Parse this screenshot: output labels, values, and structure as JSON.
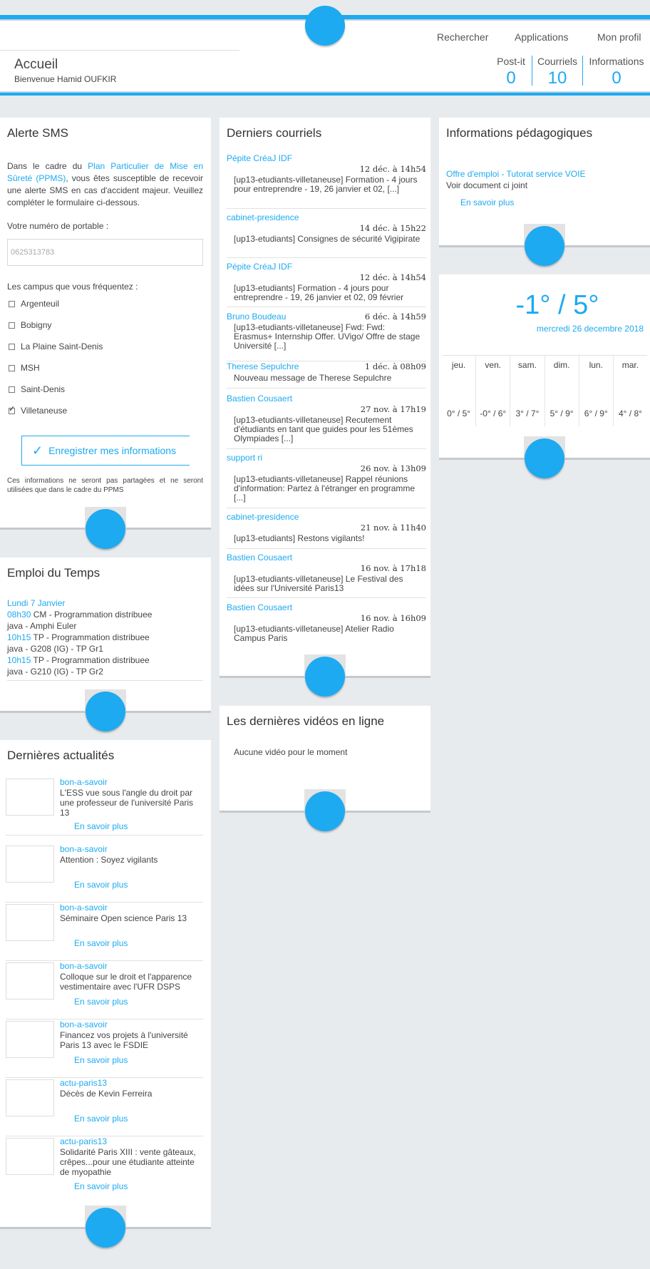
{
  "header": {
    "title": "Accueil",
    "welcome": "Bienvenue Hamid OUFKIR",
    "nav": [
      "Rechercher",
      "Applications",
      "Mon profil"
    ],
    "stats": [
      {
        "label": "Post-it",
        "value": "0"
      },
      {
        "label": "Courriels",
        "value": "10"
      },
      {
        "label": "Informations",
        "value": "0"
      }
    ]
  },
  "sms": {
    "title": "Alerte SMS",
    "intro_before": "Dans le cadre du ",
    "intro_link": "Plan Particulier de Mise en Sûreté (PPMS)",
    "intro_after": ", vous êtes susceptible de recevoir une alerte SMS en cas d'accident majeur. Veuillez compléter le formulaire ci-dessous.",
    "phone_label": "Votre numéro de portable :",
    "phone_value": "0625313783",
    "campus_label": "Les campus que vous fréquentez :",
    "campuses": [
      {
        "name": "Argenteuil",
        "checked": false
      },
      {
        "name": "Bobigny",
        "checked": false
      },
      {
        "name": "La Plaine Saint-Denis",
        "checked": false
      },
      {
        "name": "MSH",
        "checked": false
      },
      {
        "name": "Saint-Denis",
        "checked": false
      },
      {
        "name": "Villetaneuse",
        "checked": true
      }
    ],
    "save_label": "Enregistrer mes informations",
    "note": "Ces informations ne seront pas partagées et ne seront utilisées que dans le cadre du PPMS"
  },
  "schedule": {
    "title": "Emploi du Temps",
    "day": "Lundi 7 Janvier",
    "entries": [
      {
        "time": "08h30",
        "line1": " CM - Programmation distribuee",
        "line2": "java - Amphi Euler"
      },
      {
        "time": "10h15",
        "line1": " TP - Programmation distribuee",
        "line2": "java - G208 (IG) - TP Gr1"
      },
      {
        "time": "10h15",
        "line1": " TP - Programmation distribuee",
        "line2": "java - G210 (IG) - TP Gr2"
      }
    ]
  },
  "news": {
    "title": "Dernières actualités",
    "more_label": "En savoir plus",
    "items": [
      {
        "category": "bon-a-savoir",
        "title": "L'ESS vue sous l'angle du droit par une professeur de l'université Paris 13"
      },
      {
        "category": "bon-a-savoir",
        "title": "Attention : Soyez vigilants"
      },
      {
        "category": "bon-a-savoir",
        "title": "Séminaire Open science Paris 13"
      },
      {
        "category": "bon-a-savoir",
        "title": "Colloque sur le droit et l'apparence vestimentaire avec l'UFR DSPS"
      },
      {
        "category": "bon-a-savoir",
        "title": "Financez vos projets à l'université Paris 13 avec le FSDIE"
      },
      {
        "category": "actu-paris13",
        "title": "Décès de Kevin Ferreira"
      },
      {
        "category": "actu-paris13",
        "title": "Solidarité Paris XIII : vente gâteaux, crêpes...pour une étudiante atteinte de myopathie"
      }
    ]
  },
  "mails": {
    "title": "Derniers courriels",
    "items": [
      {
        "from": "Pépite CréaJ IDF",
        "date": "12 déc. à 14h54",
        "subject": "[up13-etudiants-villetaneuse] Formation - 4 jours pour entreprendre - 19, 26 janvier et 02, [...]"
      },
      {
        "from": "cabinet-presidence",
        "date": "14 déc. à 15h22",
        "subject": "[up13-etudiants] Consignes de sécurité Vigipirate"
      },
      {
        "from": "Pépite CréaJ IDF",
        "date": "12 déc. à 14h54",
        "subject": "[up13-etudiants] Formation - 4 jours pour entreprendre - 19, 26 janvier et 02, 09 février"
      },
      {
        "from": "Bruno Boudeau",
        "date": "6 déc. à 14h59",
        "subject": "[up13-etudiants-villetaneuse] Fwd: Fwd: Erasmus+ Internship Offer. UVigo/ Offre de stage Université [...]"
      },
      {
        "from": "Therese Sepulchre",
        "date": "1 déc. à 08h09",
        "subject": "Nouveau message de Therese Sepulchre"
      },
      {
        "from": "Bastien Cousaert",
        "date": "27 nov. à 17h19",
        "subject": "[up13-etudiants-villetaneuse] Recutement d'étudiants en tant que guides pour les 51èmes Olympiades [...]"
      },
      {
        "from": "support ri",
        "date": "26 nov. à 13h09",
        "subject": "[up13-etudiants-villetaneuse] Rappel réunions d'information: Partez à l'étranger en programme [...]"
      },
      {
        "from": "cabinet-presidence",
        "date": "21 nov. à 11h40",
        "subject": "[up13-etudiants] Restons vigilants!"
      },
      {
        "from": "Bastien Cousaert",
        "date": "16 nov. à 17h18",
        "subject": "[up13-etudiants-villetaneuse] Le Festival des idées sur l'Université Paris13"
      },
      {
        "from": "Bastien Cousaert",
        "date": "16 nov. à 16h09",
        "subject": "[up13-etudiants-villetaneuse] Atelier Radio Campus Paris"
      }
    ]
  },
  "videos": {
    "title": "Les dernières vidéos en ligne",
    "empty": "Aucune vidéo pour le moment"
  },
  "pedago": {
    "title": "Informations pédagogiques",
    "link": "Offre d'emploi - Tutorat service VOIE",
    "desc": "Voir document ci joint",
    "more": "En savoir plus"
  },
  "weather": {
    "temp": "-1° / 5°",
    "date": "mercredi 26 decembre 2018",
    "days": [
      {
        "name": "jeu.",
        "temp": "0° / 5°"
      },
      {
        "name": "ven.",
        "temp": "-0° / 6°"
      },
      {
        "name": "sam.",
        "temp": "3° / 7°"
      },
      {
        "name": "dim.",
        "temp": "5° / 9°"
      },
      {
        "name": "lun.",
        "temp": "6° / 9°"
      },
      {
        "name": "mar.",
        "temp": "4° / 8°"
      }
    ]
  },
  "colors": {
    "accent": "#1daaf1",
    "background": "#e8ebee"
  }
}
